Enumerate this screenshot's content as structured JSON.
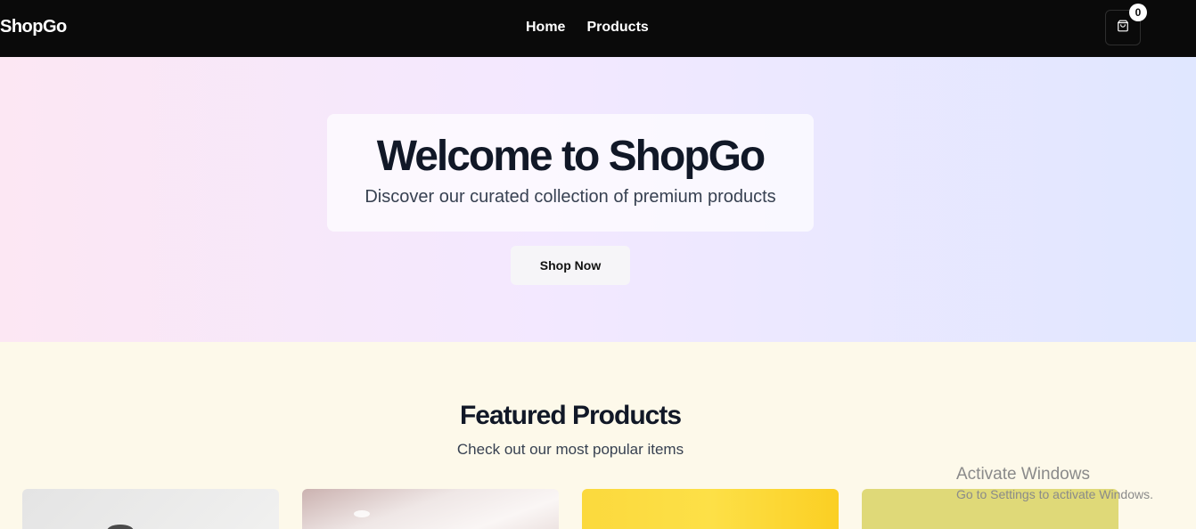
{
  "navbar": {
    "brand": "ShopGo",
    "links": [
      "Home",
      "Products"
    ],
    "cart_count": "0",
    "cart_icon": "shopping-bag-icon"
  },
  "hero": {
    "title": "Welcome to ShopGo",
    "subtitle": "Discover our curated collection of premium products",
    "cta_label": "Shop Now"
  },
  "featured": {
    "title": "Featured Products",
    "subtitle": "Check out our most popular items"
  },
  "watermark": {
    "title": "Activate Windows",
    "subtitle": "Go to Settings to activate Windows."
  },
  "colors": {
    "navbar_bg": "#0a0a0a",
    "hero_gradient": [
      "#fce7f3",
      "#f3e8ff",
      "#e0e7ff"
    ],
    "featured_bg": "#fdf9ea",
    "heading": "#111827"
  }
}
